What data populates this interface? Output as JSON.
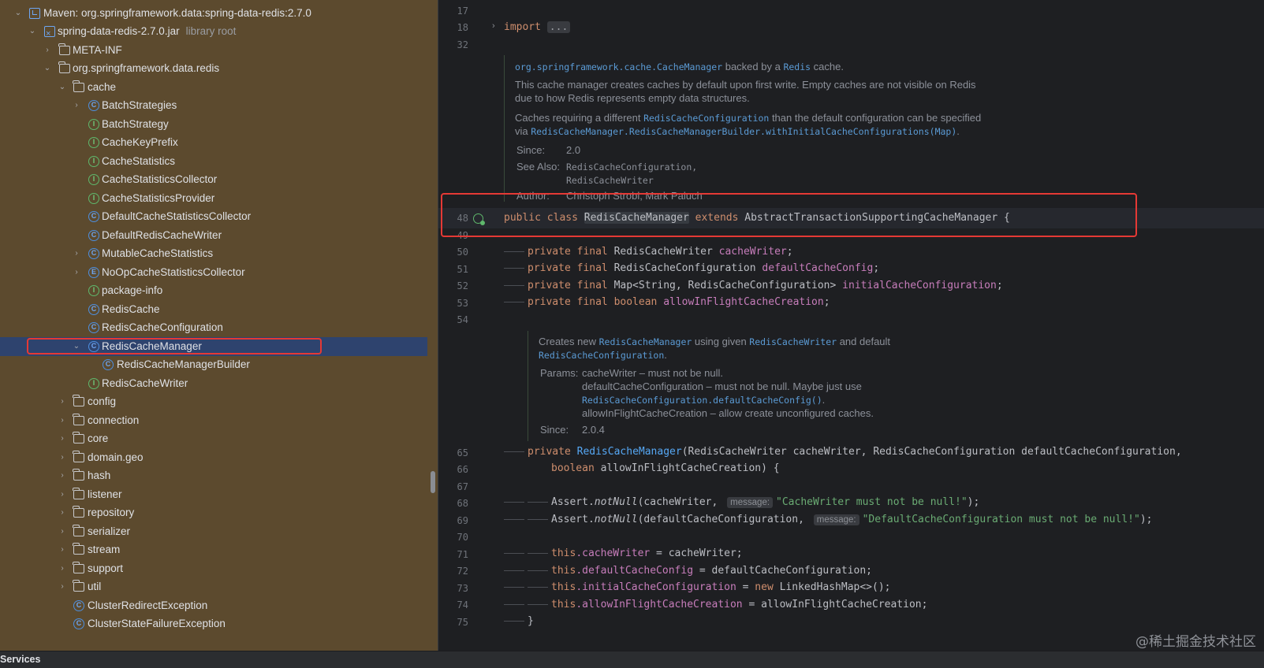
{
  "project_tree": {
    "root_label": "Maven: org.springframework.data:spring-data-redis:2.7.0",
    "jar_label": "spring-data-redis-2.7.0.jar",
    "jar_hint": "library root",
    "meta_inf": "META-INF",
    "package": "org.springframework.data.redis",
    "cache_folder": "cache",
    "cache_items": [
      {
        "label": "BatchStrategies",
        "icon": "class-icon"
      },
      {
        "label": "BatchStrategy",
        "icon": "interface-icon"
      },
      {
        "label": "CacheKeyPrefix",
        "icon": "interface-icon"
      },
      {
        "label": "CacheStatistics",
        "icon": "interface-icon"
      },
      {
        "label": "CacheStatisticsCollector",
        "icon": "interface-icon"
      },
      {
        "label": "CacheStatisticsProvider",
        "icon": "interface-icon"
      },
      {
        "label": "DefaultCacheStatisticsCollector",
        "icon": "class-icon"
      },
      {
        "label": "DefaultRedisCacheWriter",
        "icon": "class-icon"
      },
      {
        "label": "MutableCacheStatistics",
        "icon": "class-icon"
      },
      {
        "label": "NoOpCacheStatisticsCollector",
        "icon": "enum-icon"
      },
      {
        "label": "package-info",
        "icon": "interface-icon"
      },
      {
        "label": "RedisCache",
        "icon": "class-icon"
      },
      {
        "label": "RedisCacheConfiguration",
        "icon": "class-icon"
      },
      {
        "label": "RedisCacheManager",
        "icon": "class-icon"
      },
      {
        "label": "RedisCacheManagerBuilder",
        "icon": "class-icon"
      },
      {
        "label": "RedisCacheWriter",
        "icon": "interface-icon"
      }
    ],
    "folders": [
      "config",
      "connection",
      "core",
      "domain.geo",
      "hash",
      "listener",
      "repository",
      "serializer",
      "stream",
      "support",
      "util"
    ],
    "exceptions": [
      "ClusterRedirectException",
      "ClusterStateFailureException"
    ]
  },
  "editor": {
    "line_numbers": [
      "17",
      "18",
      "32",
      "48",
      "49",
      "50",
      "51",
      "52",
      "53",
      "54",
      "65",
      "66",
      "67",
      "68",
      "69",
      "70",
      "71",
      "72",
      "73",
      "74",
      "75"
    ],
    "import_keyword": "import",
    "import_fold": "...",
    "doc1": {
      "line1_code": "org.springframework.cache.CacheManager",
      "line1_text": " backed by a ",
      "line1_code2": "Redis",
      "line1_text2": " cache.",
      "para1_line1": "This cache manager creates caches by default upon first write. Empty caches are not visible on Redis",
      "para1_line2": "due to how Redis represents empty data structures.",
      "para2_line1_a": "Caches requiring a different ",
      "para2_line1_code": "RedisCacheConfiguration",
      "para2_line1_b": " than the default configuration can be specified",
      "para2_line2_a": "via ",
      "para2_line2_code": "RedisCacheManager.RedisCacheManagerBuilder.withInitialCacheConfigurations(Map)",
      "para2_line2_b": ".",
      "since_label": "Since:",
      "since_value": "2.0",
      "see_label": "See Also:",
      "see_value1": "RedisCacheConfiguration,",
      "see_value2": "RedisCacheWriter",
      "author_label": "Author:",
      "author_value": "Christoph Strobl, Mark Paluch"
    },
    "class_decl": {
      "public": "public",
      "class": "class",
      "name": "RedisCacheManager",
      "extends": "extends",
      "parent": "AbstractTransactionSupportingCacheManager {"
    },
    "fields": [
      {
        "mods": "private final",
        "type": " RedisCacheWriter ",
        "name": "cacheWriter",
        "end": ";"
      },
      {
        "mods": "private final",
        "type": " RedisCacheConfiguration ",
        "name": "defaultCacheConfig",
        "end": ";"
      },
      {
        "mods": "private final",
        "type": " Map<String, RedisCacheConfiguration> ",
        "name": "initialCacheConfiguration",
        "end": ";"
      },
      {
        "mods": "private final boolean",
        "type": " ",
        "name": "allowInFlightCacheCreation",
        "end": ";"
      }
    ],
    "doc2": {
      "line1_a": "Creates new ",
      "line1_code1": "RedisCacheManager",
      "line1_b": " using given ",
      "line1_code2": "RedisCacheWriter",
      "line1_c": " and default",
      "line2_code": "RedisCacheConfiguration",
      "line2_b": ".",
      "params_label": "Params:",
      "param1": "cacheWriter – must not be null.",
      "param2": "defaultCacheConfiguration – must not be null. Maybe just use",
      "param3_code": "RedisCacheConfiguration.defaultCacheConfig()",
      "param3_b": ".",
      "param4": "allowInFlightCacheCreation – allow create unconfigured caches.",
      "since_label": "Since:",
      "since_value": "2.0.4"
    },
    "ctor": {
      "l65_kw": "private",
      "l65_name": "RedisCacheManager",
      "l65_rest": "(RedisCacheWriter cacheWriter, RedisCacheConfiguration defaultCacheConfiguration,",
      "l66_kw": "boolean",
      "l66_rest": " allowInFlightCacheCreation) {",
      "l68_pre": "Assert.",
      "l68_method": "notNull",
      "l68_arg": "(cacheWriter, ",
      "l68_hint": "message:",
      "l68_str": "\"CacheWriter must not be null!\"",
      "l68_end": ");",
      "l69_pre": "Assert.",
      "l69_method": "notNull",
      "l69_arg": "(defaultCacheConfiguration, ",
      "l69_hint": "message:",
      "l69_str": "\"DefaultCacheConfiguration must not be null!\"",
      "l69_end": ");",
      "assigns": [
        {
          "this": "this",
          "field": ".cacheWriter",
          "rest": " = cacheWriter;"
        },
        {
          "this": "this",
          "field": ".defaultCacheConfig",
          "rest": " = defaultCacheConfiguration;"
        },
        {
          "this": "this",
          "field": ".initialCacheConfiguration",
          "rest": " = ",
          "new": "new",
          "rest2": " LinkedHashMap<>();"
        },
        {
          "this": "this",
          "field": ".allowInFlightCacheCreation",
          "rest": " = allowInFlightCacheCreation;"
        }
      ],
      "l75": "}"
    }
  },
  "bottom_bar": {
    "services_label": "Services"
  },
  "watermark": "@稀土掘金技术社区",
  "colors": {
    "highlight_box": "#e53935",
    "tree_bg": "#5c4a2e",
    "editor_bg": "#1e1f22",
    "selection": "#2e436e"
  }
}
